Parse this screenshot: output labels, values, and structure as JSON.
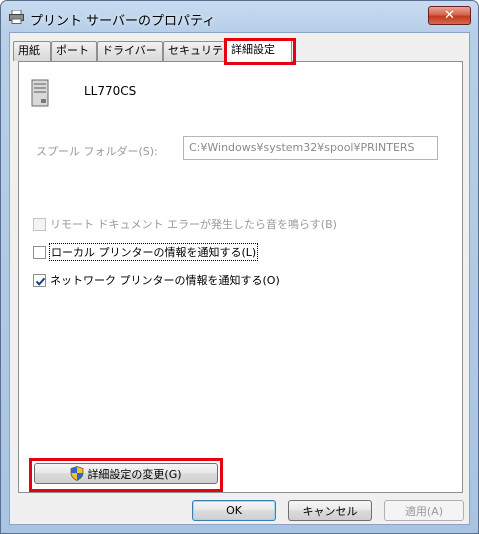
{
  "window": {
    "title": "プリント サーバーのプロパティ",
    "close_label": "✕"
  },
  "tabs": [
    {
      "label": "用紙"
    },
    {
      "label": "ポート"
    },
    {
      "label": "ドライバー"
    },
    {
      "label": "セキュリティ"
    },
    {
      "label": "詳細設定"
    }
  ],
  "active_tab": "詳細設定",
  "panel": {
    "printer_name": "LL770CS",
    "spool_label": "スプール フォルダー(S):",
    "spool_value": "C:¥Windows¥system32¥spool¥PRINTERS",
    "checks": [
      {
        "label": "リモート ドキュメント エラーが発生したら音を鳴らす(B)",
        "checked": false,
        "enabled": false
      },
      {
        "label": "ローカル プリンターの情報を通知する(L)",
        "checked": false,
        "enabled": true
      },
      {
        "label": "ネットワーク プリンターの情報を通知する(O)",
        "checked": true,
        "enabled": true
      }
    ],
    "change_settings_label": "詳細設定の変更(G)"
  },
  "footer": {
    "ok_label": "OK",
    "cancel_label": "キャンセル",
    "apply_label": "適用(A)"
  },
  "colors": {
    "highlight": "#e60012",
    "titlebar": "#b7cfe9"
  }
}
